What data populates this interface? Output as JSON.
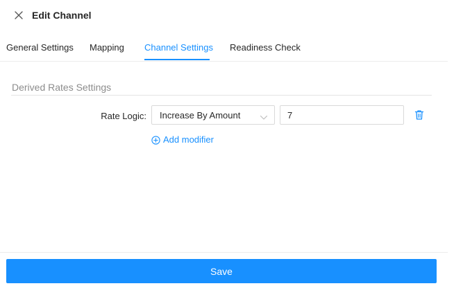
{
  "header": {
    "title": "Edit Channel",
    "close_icon": "close-icon"
  },
  "tabs": [
    {
      "label": "General Settings",
      "active": false
    },
    {
      "label": "Mapping",
      "active": false
    },
    {
      "label": "Channel Settings",
      "active": true
    },
    {
      "label": "Readiness Check",
      "active": false
    }
  ],
  "section": {
    "title": "Derived Rates Settings"
  },
  "rate_logic": {
    "label": "Rate Logic:",
    "selected": "Increase By Amount",
    "amount_value": "7"
  },
  "add_modifier": {
    "label": "Add modifier"
  },
  "footer": {
    "save_label": "Save"
  },
  "colors": {
    "accent": "#1890ff",
    "text": "#262626",
    "muted": "#8c8c8c",
    "border": "#d9d9d9"
  }
}
